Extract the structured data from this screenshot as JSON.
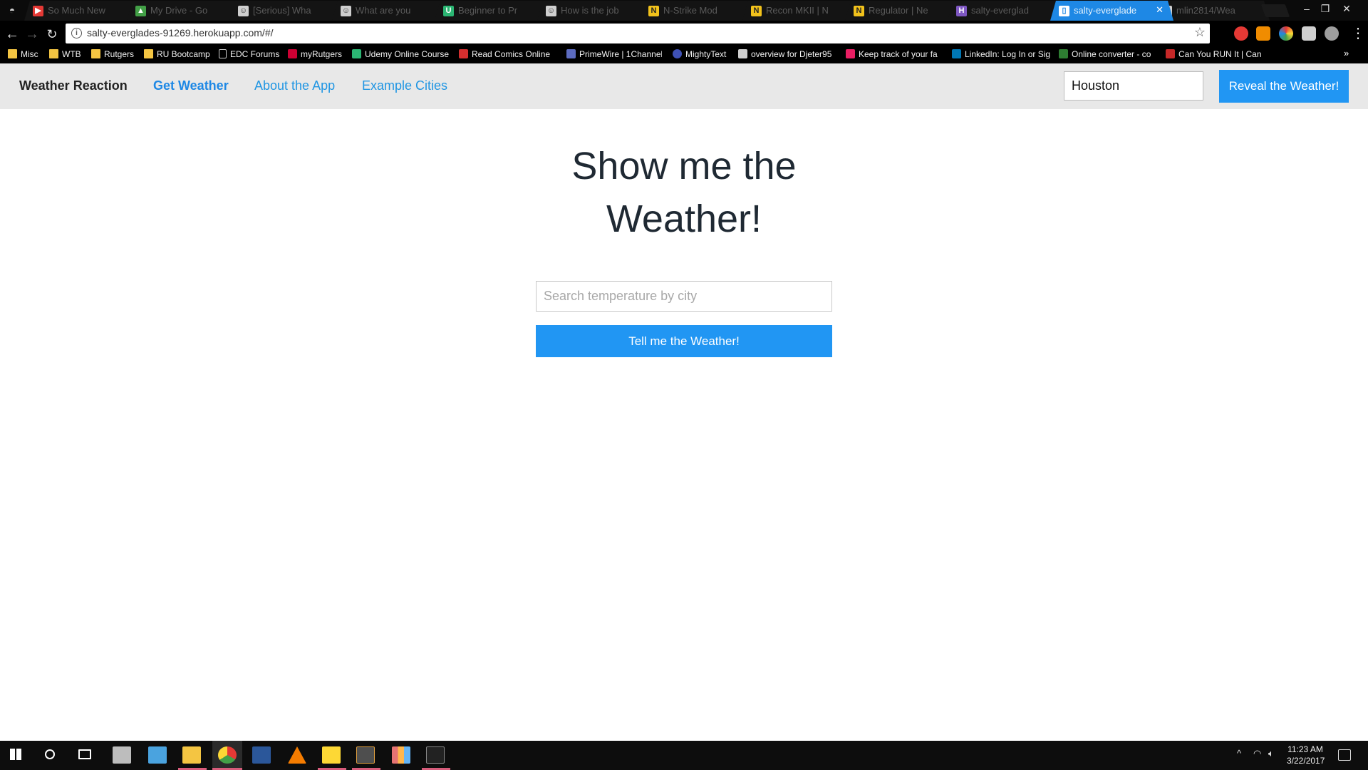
{
  "browser": {
    "tabs": [
      {
        "title": "So Much New",
        "icon_color": "#e53935",
        "icon": "youtube-icon"
      },
      {
        "title": "My Drive - Go",
        "icon_color": "#43a047",
        "icon": "google-drive-icon"
      },
      {
        "title": "[Serious] Wha",
        "icon_color": "#cfcfcf",
        "icon": "reddit-icon"
      },
      {
        "title": "What are you",
        "icon_color": "#cfcfcf",
        "icon": "reddit-icon"
      },
      {
        "title": "Beginner to Pr",
        "icon_color": "#2bb673",
        "icon": "udemy-icon"
      },
      {
        "title": "How is the job",
        "icon_color": "#cfcfcf",
        "icon": "reddit-icon"
      },
      {
        "title": "N-Strike Mod",
        "icon_color": "#f2c21b",
        "icon": "n-icon"
      },
      {
        "title": "Recon MKII | N",
        "icon_color": "#f2c21b",
        "icon": "n-icon"
      },
      {
        "title": "Regulator | Ne",
        "icon_color": "#f2c21b",
        "icon": "n-icon"
      },
      {
        "title": "salty-everglad",
        "icon_color": "#7e57c2",
        "icon": "heroku-icon"
      },
      {
        "title": "salty-everglade",
        "icon_color": "#ffffff",
        "icon": "page-icon",
        "active": true
      },
      {
        "title": "mlin2814/Wea",
        "icon_color": "#cfcfcf",
        "icon": "github-icon"
      }
    ],
    "url": "salty-everglades-91269.herokuapp.com/#/",
    "bookmarks": [
      {
        "label": "Misc",
        "icon": "folder"
      },
      {
        "label": "WTB",
        "icon": "folder"
      },
      {
        "label": "Rutgers",
        "icon": "folder"
      },
      {
        "label": "RU Bootcamp",
        "icon": "folder"
      },
      {
        "label": "EDC Forums",
        "icon": "page"
      },
      {
        "label": "myRutgers",
        "icon": "rutgers"
      },
      {
        "label": "Udemy Online Course",
        "icon": "udemy"
      },
      {
        "label": "Read Comics Online F",
        "icon": "comics"
      },
      {
        "label": "PrimeWire | 1Channel",
        "icon": "primewire"
      },
      {
        "label": "MightyText",
        "icon": "mightytext"
      },
      {
        "label": "overview for Djeter95",
        "icon": "reddit"
      },
      {
        "label": "Keep track of your fa",
        "icon": "keep"
      },
      {
        "label": "LinkedIn: Log In or Sig",
        "icon": "linkedin"
      },
      {
        "label": "Online converter - co",
        "icon": "converter"
      },
      {
        "label": "Can You RUN It | Can",
        "icon": "canyourunit"
      }
    ]
  },
  "app": {
    "brand": "Weather Reaction",
    "nav_links": [
      "Get Weather",
      "About the App",
      "Example Cities"
    ],
    "nav_search_value": "Houston",
    "nav_button": "Reveal the Weather!",
    "heading": "Show me the Weather!",
    "search_placeholder": "Search temperature by city",
    "submit_button": "Tell me the Weather!"
  },
  "taskbar": {
    "time": "11:23 AM",
    "date": "3/22/2017"
  },
  "colors": {
    "accent": "#2196f3",
    "active_tab": "#1e88e5",
    "navbar_bg": "#e8e8e8"
  }
}
